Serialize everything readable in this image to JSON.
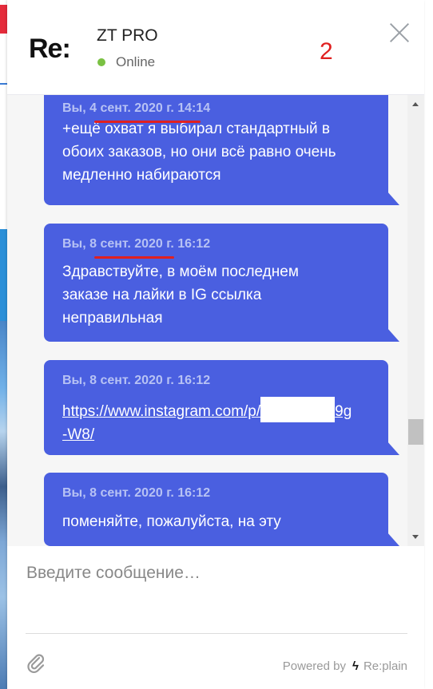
{
  "header": {
    "logo": "Re:",
    "agent_name": "ZT PRO",
    "status": "Online",
    "annotation": "2"
  },
  "messages": [
    {
      "timestamp": "Вы, 4 сент. 2020 г. 14:14",
      "lines": [
        "+ещё охват я выбирал стандартный в",
        "обоих заказов, но они всё равно очень",
        "медленно набираются"
      ]
    },
    {
      "timestamp": "Вы, 8 сент. 2020 г. 16:12",
      "lines": [
        "Здравствуйте, в моём последнем",
        "заказе на лайки в IG ссылка",
        "неправильная"
      ]
    },
    {
      "timestamp": "Вы, 8 сент. 2020 г. 16:12",
      "link_start": "https://www.instagram.com/p/",
      "link_end": "9g",
      "link_line2": "-W8/"
    },
    {
      "timestamp": "Вы, 8 сент. 2020 г. 16:12",
      "lines": [
        "поменяйте, пожалуйста, на эту"
      ]
    }
  ],
  "composer": {
    "placeholder": "Введите сообщение…",
    "powered_by": "Powered by",
    "brand": "Re:plain"
  }
}
